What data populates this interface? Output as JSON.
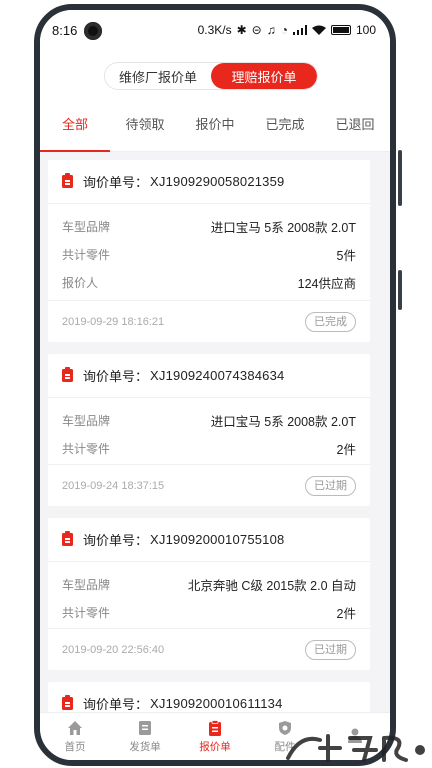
{
  "status_bar": {
    "time": "8:16",
    "speed": "0.3K/s",
    "battery": "100"
  },
  "segment": {
    "items": [
      "维修厂报价单",
      "理赔报价单"
    ],
    "active_index": 1
  },
  "tabs": {
    "items": [
      "全部",
      "待领取",
      "报价中",
      "已完成",
      "已退回"
    ],
    "active_index": 0
  },
  "orders": [
    {
      "label": "询价单号：",
      "number": "XJ1909290058021359",
      "rows": [
        {
          "key": "车型品牌",
          "value": "进口宝马 5系 2008款 2.0T"
        },
        {
          "key": "共计零件",
          "value": "5件"
        },
        {
          "key": "报价人",
          "value": "124供应商"
        }
      ],
      "time": "2019-09-29 18:16:21",
      "status": "已完成"
    },
    {
      "label": "询价单号：",
      "number": "XJ1909240074384634",
      "rows": [
        {
          "key": "车型品牌",
          "value": "进口宝马 5系 2008款 2.0T"
        },
        {
          "key": "共计零件",
          "value": "2件"
        }
      ],
      "time": "2019-09-24 18:37:15",
      "status": "已过期"
    },
    {
      "label": "询价单号：",
      "number": "XJ1909200010755108",
      "rows": [
        {
          "key": "车型品牌",
          "value": "北京奔驰 C级 2015款 2.0 自动"
        },
        {
          "key": "共计零件",
          "value": "2件"
        }
      ],
      "time": "2019-09-20 22:56:40",
      "status": "已过期"
    },
    {
      "label": "询价单号：",
      "number": "XJ1909200010611134"
    }
  ],
  "bottom_nav": {
    "items": [
      {
        "label": "首页",
        "icon": "home-icon"
      },
      {
        "label": "发货单",
        "icon": "document-icon"
      },
      {
        "label": "报价单",
        "icon": "clipboard-icon"
      },
      {
        "label": "配件",
        "icon": "shield-icon"
      },
      {
        "label": "",
        "icon": "user-icon"
      }
    ],
    "active_index": 2
  },
  "colors": {
    "accent": "#e8281c",
    "background": "#f4f4f6",
    "muted": "#888888"
  }
}
